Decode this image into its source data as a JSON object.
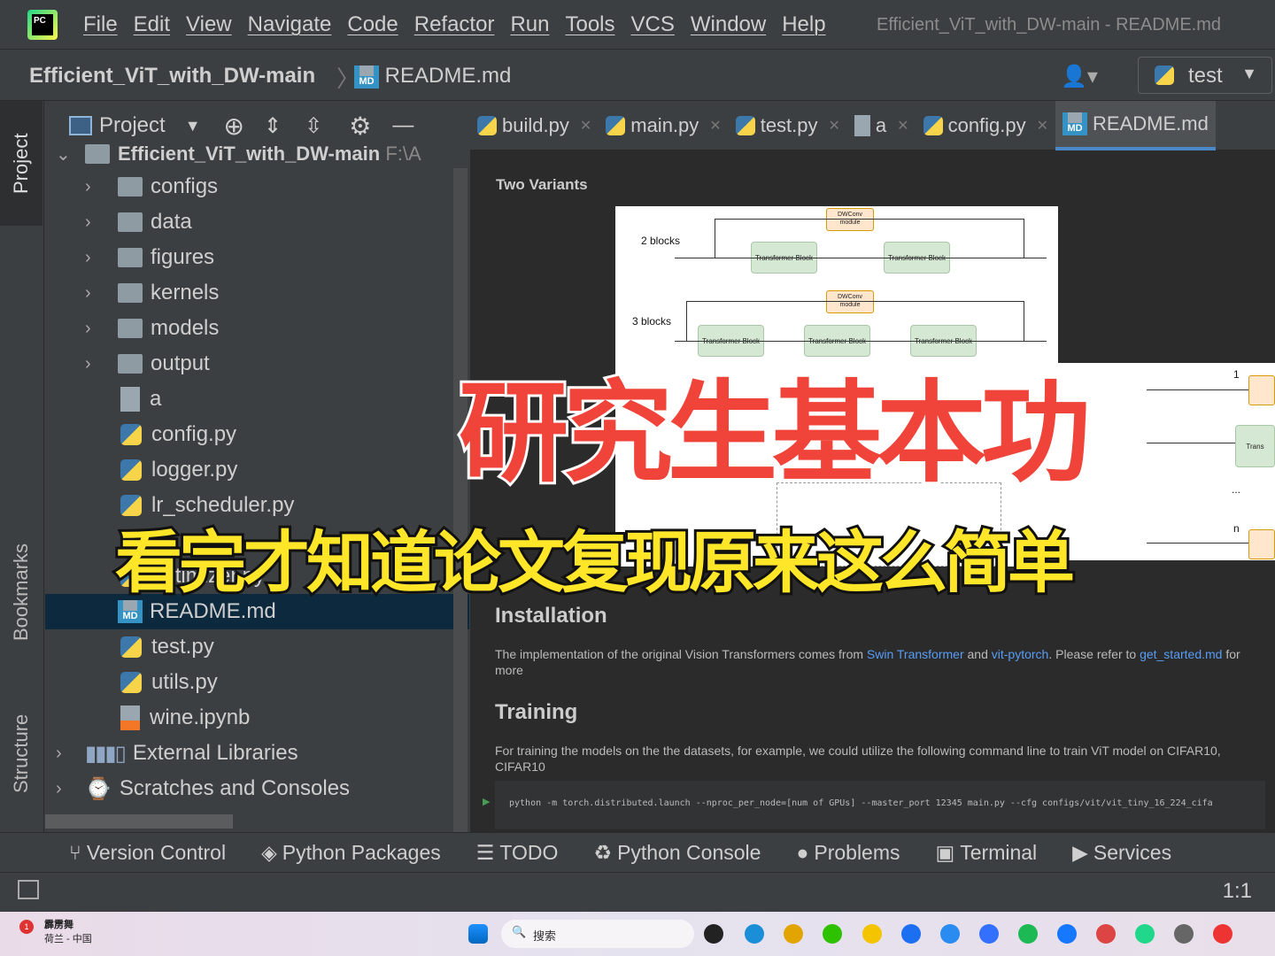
{
  "menubar": {
    "items": [
      "File",
      "Edit",
      "View",
      "Navigate",
      "Code",
      "Refactor",
      "Run",
      "Tools",
      "VCS",
      "Window",
      "Help"
    ],
    "window_title": "Efficient_ViT_with_DW-main - README.md"
  },
  "navbar": {
    "project": "Efficient_ViT_with_DW-main",
    "file": "README.md",
    "run_config": "test"
  },
  "left_strip": {
    "project": "Project",
    "bookmarks": "Bookmarks",
    "structure": "Structure"
  },
  "project_panel": {
    "title": "Project",
    "root": "Efficient_ViT_with_DW-main",
    "root_path": "F:\\A",
    "items": [
      {
        "label": "configs",
        "type": "folder"
      },
      {
        "label": "data",
        "type": "folder"
      },
      {
        "label": "figures",
        "type": "folder"
      },
      {
        "label": "kernels",
        "type": "folder"
      },
      {
        "label": "models",
        "type": "folder"
      },
      {
        "label": "output",
        "type": "folder"
      },
      {
        "label": "a",
        "type": "file"
      },
      {
        "label": "config.py",
        "type": "py"
      },
      {
        "label": "logger.py",
        "type": "py"
      },
      {
        "label": "lr_scheduler.py",
        "type": "py"
      },
      {
        "label": "optimizer.py",
        "type": "py"
      },
      {
        "label": "README.md",
        "type": "md",
        "selected": true
      },
      {
        "label": "test.py",
        "type": "py"
      },
      {
        "label": "utils.py",
        "type": "py"
      },
      {
        "label": "wine.ipynb",
        "type": "ipynb"
      }
    ],
    "external_libraries": "External Libraries",
    "scratches": "Scratches and Consoles"
  },
  "tabs": [
    {
      "label": "build.py"
    },
    {
      "label": "main.py"
    },
    {
      "label": "test.py"
    },
    {
      "label": "a"
    },
    {
      "label": "config.py"
    },
    {
      "label": "README.md",
      "active": true
    }
  ],
  "editor": {
    "variants_heading": "Two Variants",
    "diagram": {
      "two_blocks": "2 blocks",
      "three_blocks": "3 blocks",
      "dwconv": "DWConv module",
      "transformer": "Transformer Block",
      "one": "1",
      "n": "n",
      "dots": "...",
      "trans": "Trans"
    },
    "installation_heading": "Installation",
    "installation_text": {
      "pre": "The implementation of the original Vision Transformers comes from ",
      "link1": "Swin Transformer",
      "mid1": " and ",
      "link2": "vit-pytorch",
      "mid2": ". Please refer to ",
      "link3": "get_started.md",
      "post": " for more"
    },
    "training_heading": "Training",
    "training_text": "For training the models on the the datasets, for example, we could utilize the following command line to train ViT model on CIFAR10, CIFAR10",
    "code": "python -m torch.distributed.launch --nproc_per_node=[num of GPUs] --master_port 12345 main.py --cfg configs/vit/vit_tiny_16_224_cifa"
  },
  "overlay": {
    "title": "研究生基本功",
    "subtitle": "看完才知道论文复现原来这么简单",
    "title_color": "#f0443a",
    "subtitle_color": "#ffe629"
  },
  "bottombar": [
    "Version Control",
    "Python Packages",
    "TODO",
    "Python Console",
    "Problems",
    "Terminal",
    "Services"
  ],
  "statusbar": {
    "position": "1:1"
  },
  "taskbar": {
    "badge": "1",
    "weather_line1": "霹雳舞",
    "weather_line2": "荷兰 - 中国",
    "search_placeholder": "搜索"
  },
  "colors": {
    "accent": "#4a88c7",
    "selection": "#0d293e",
    "link": "#589df6"
  }
}
